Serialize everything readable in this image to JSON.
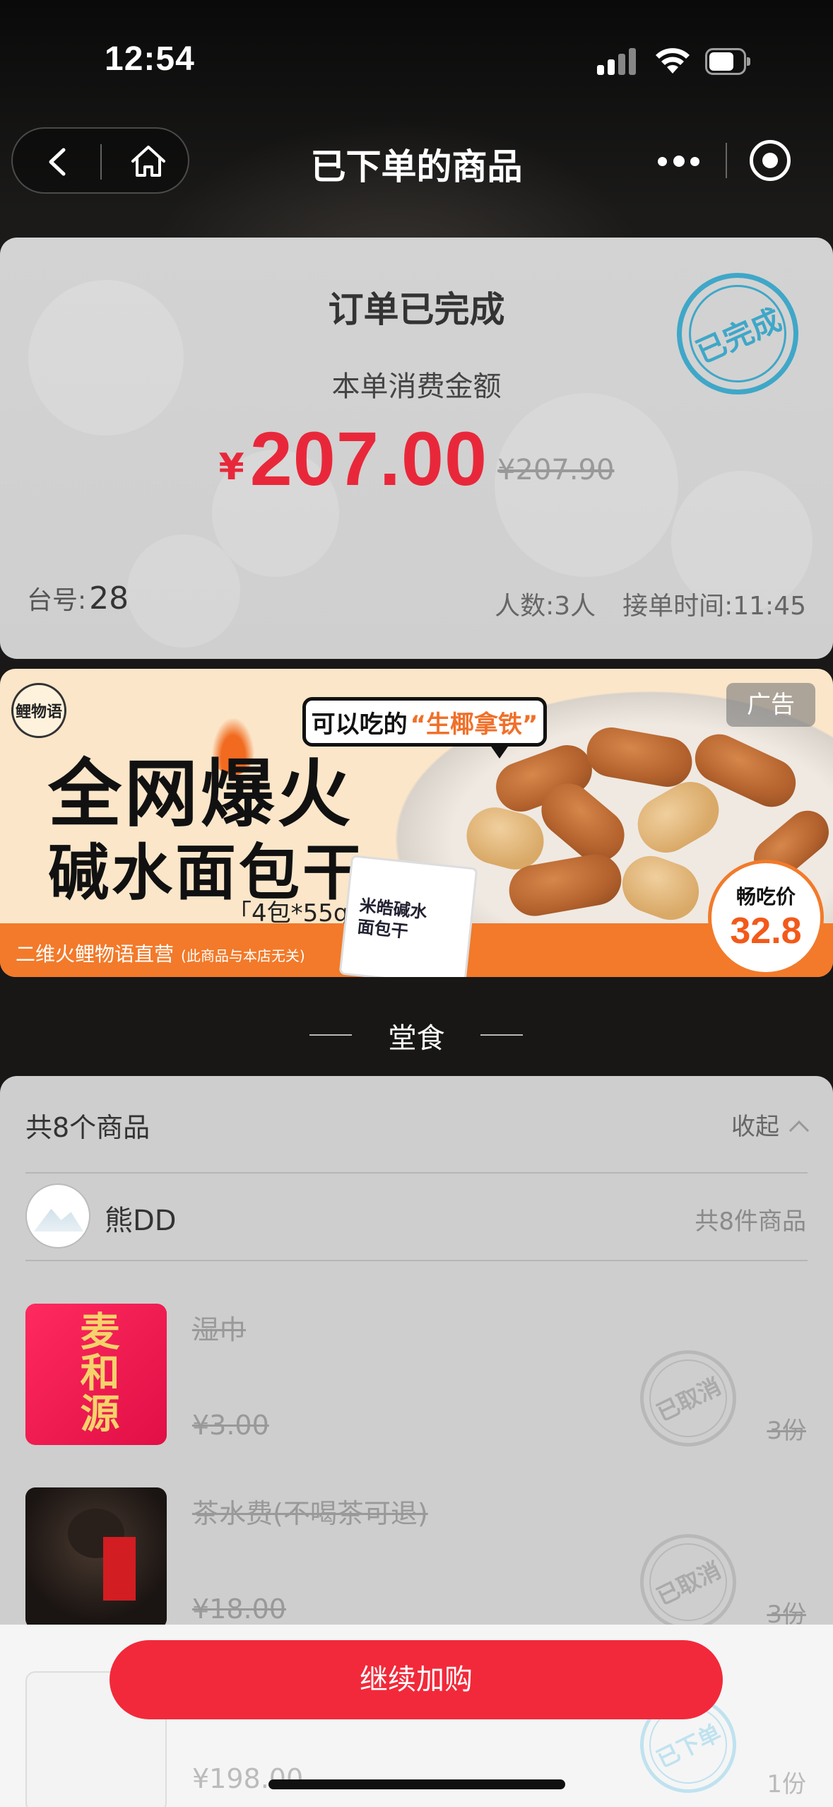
{
  "status_bar": {
    "time": "12:54"
  },
  "nav": {
    "title": "已下单的商品"
  },
  "order": {
    "status": "订单已完成",
    "amount_label": "本单消费金额",
    "currency": "¥",
    "amount": "207.00",
    "original_amount": "¥207.90",
    "stamp": "已完成",
    "table_label": "台号:",
    "table_no": "28",
    "people": "人数:3人",
    "accept_time": "接单时间:11:45",
    "accent_color": "#e8283a"
  },
  "ad": {
    "logo": "鲤物语",
    "tag": "广告",
    "bubble_prefix": "可以吃的",
    "bubble_highlight": "“生椰拿铁”",
    "headline1": "全网爆火",
    "headline2": "碱水面包干",
    "spec": "「4包*55g」",
    "pack_label_1": "米皓碱水",
    "pack_label_2": "面包干",
    "price_label": "畅吃价",
    "price_value": "32.8",
    "footer": "二维火鲤物语直营",
    "footer_note": "(此商品与本店无关)"
  },
  "section": {
    "title": "堂食"
  },
  "list": {
    "count": "共8个商品",
    "collapse": "收起",
    "user": {
      "name": "熊DD",
      "items": "共8件商品"
    },
    "items": [
      {
        "name": "湿巾",
        "price": "¥3.00",
        "qty": "3份",
        "stamp": "已取消",
        "thumb_text": "麦和源"
      },
      {
        "name": "茶水费(不喝茶可退)",
        "price": "¥18.00",
        "qty": "3份",
        "stamp": "已取消"
      },
      {
        "name": "",
        "price": "¥198.00",
        "qty": "1份",
        "stamp": "已下单"
      }
    ]
  },
  "bottom": {
    "continue": "继续加购",
    "button_color": "#f2293a"
  }
}
